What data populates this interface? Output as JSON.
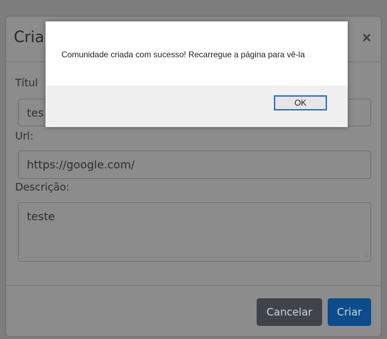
{
  "modal": {
    "title": "Cria",
    "close": "×",
    "fields": {
      "title_label": "Títul",
      "title_value": "tes",
      "url_label": "Url:",
      "url_value": "https://google.com/",
      "desc_label": "Descrição:",
      "desc_value": "teste"
    },
    "buttons": {
      "cancel": "Cancelar",
      "create": "Criar"
    }
  },
  "alert": {
    "message": "Comunidade criada com sucesso! Recarregue a página para vê-la",
    "ok": "OK"
  },
  "colors": {
    "backdrop": "#7d7d7d",
    "modal": "#8c8c8c",
    "cancel_button": "#3e4449",
    "create_button": "#0b4c8c",
    "ok_focus_border": "#2f6fc9"
  }
}
